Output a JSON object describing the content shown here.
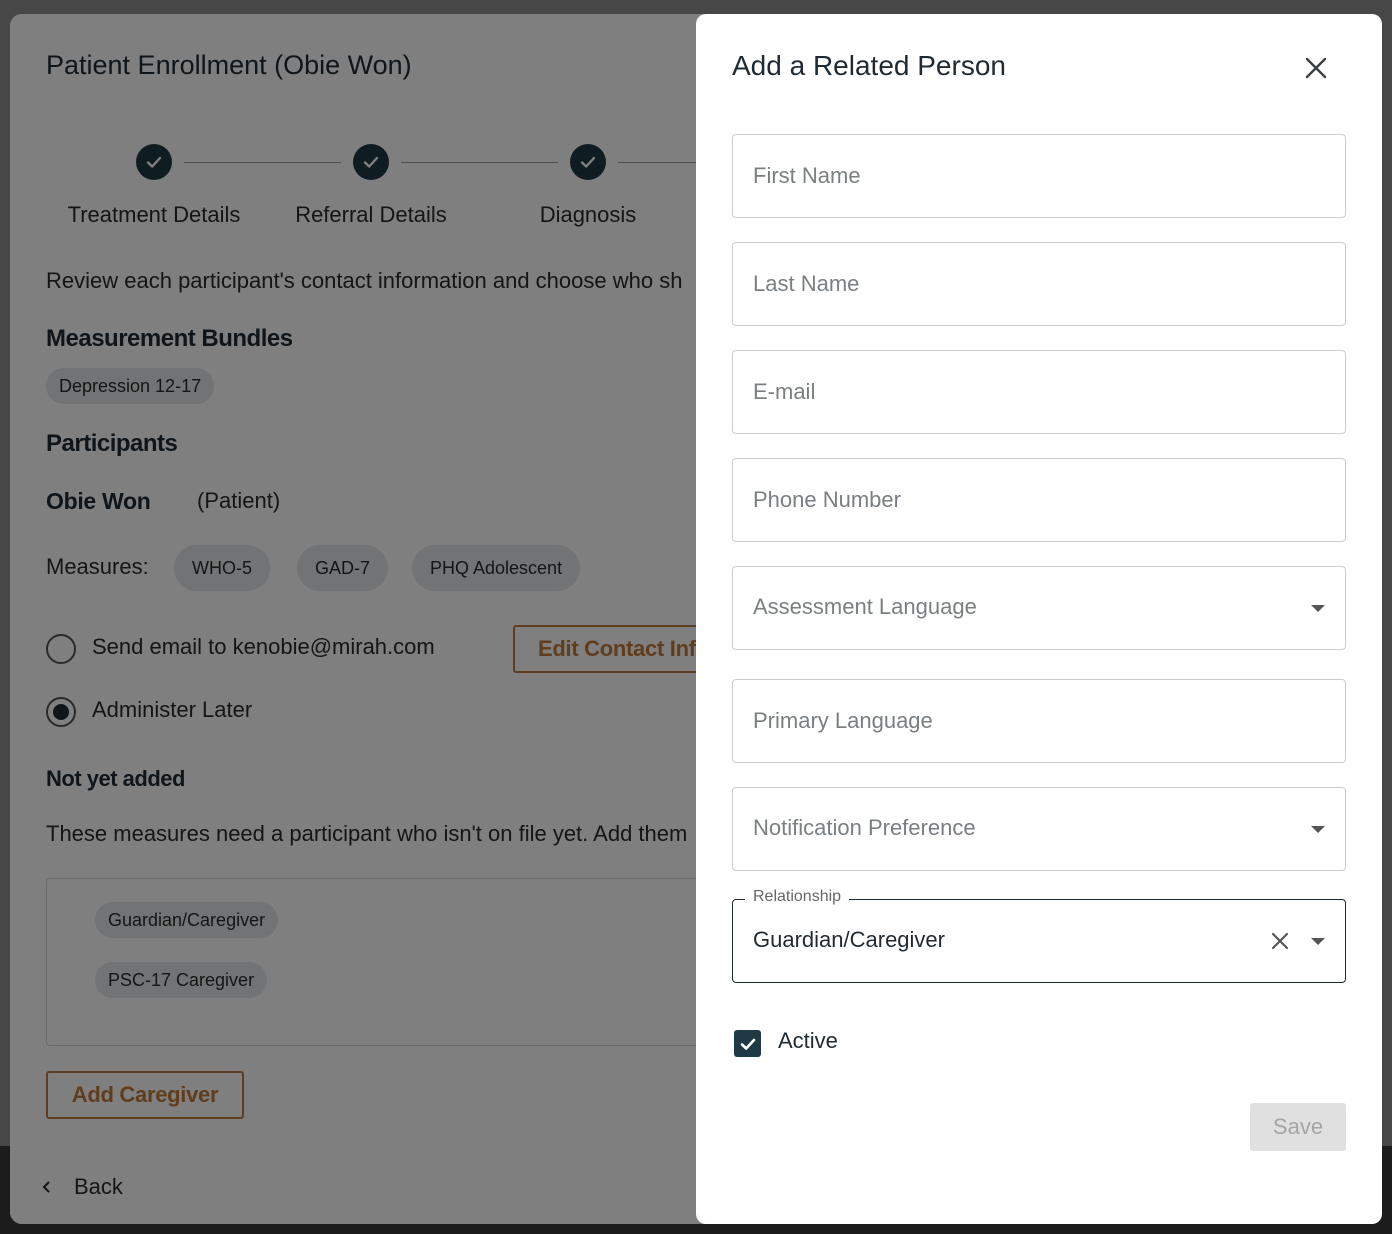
{
  "enrollment": {
    "title": "Patient Enrollment (Obie Won)",
    "steps": [
      {
        "label": "Treatment Details",
        "done": true
      },
      {
        "label": "Referral Details",
        "done": true
      },
      {
        "label": "Diagnosis",
        "done": true
      }
    ],
    "description": "Review each participant's contact information and choose who sh",
    "bundles_heading": "Measurement Bundles",
    "bundles": [
      "Depression 12-17"
    ],
    "participants_heading": "Participants",
    "participant_name": "Obie Won",
    "participant_role": "(Patient)",
    "measures_label": "Measures:",
    "measures": [
      "WHO-5",
      "GAD-7",
      "PHQ Adolescent"
    ],
    "send_email_label": "Send email to kenobie@mirah.com",
    "edit_contact_label": "Edit Contact Info",
    "administer_later_label": "Administer Later",
    "not_yet_added_heading": "Not yet added",
    "not_yet_added_desc": "These measures need a participant who isn't on file yet. Add them",
    "not_yet_added_chips": [
      "Guardian/Caregiver",
      "PSC-17 Caregiver"
    ],
    "add_caregiver_label": "Add Caregiver",
    "back_label": "Back"
  },
  "related_person": {
    "title": "Add a Related Person",
    "first_name_placeholder": "First Name",
    "last_name_placeholder": "Last Name",
    "email_placeholder": "E-mail",
    "phone_placeholder": "Phone Number",
    "assessment_language_placeholder": "Assessment Language",
    "primary_language_placeholder": "Primary Language",
    "notification_preference_placeholder": "Notification Preference",
    "relationship_label": "Relationship",
    "relationship_value": "Guardian/Caregiver",
    "active_label": "Active",
    "active_checked": true,
    "save_label": "Save"
  },
  "colors": {
    "accent": "#1f3a44",
    "outline_button": "#c07a3a",
    "save_disabled_bg": "#e0e0e0"
  }
}
